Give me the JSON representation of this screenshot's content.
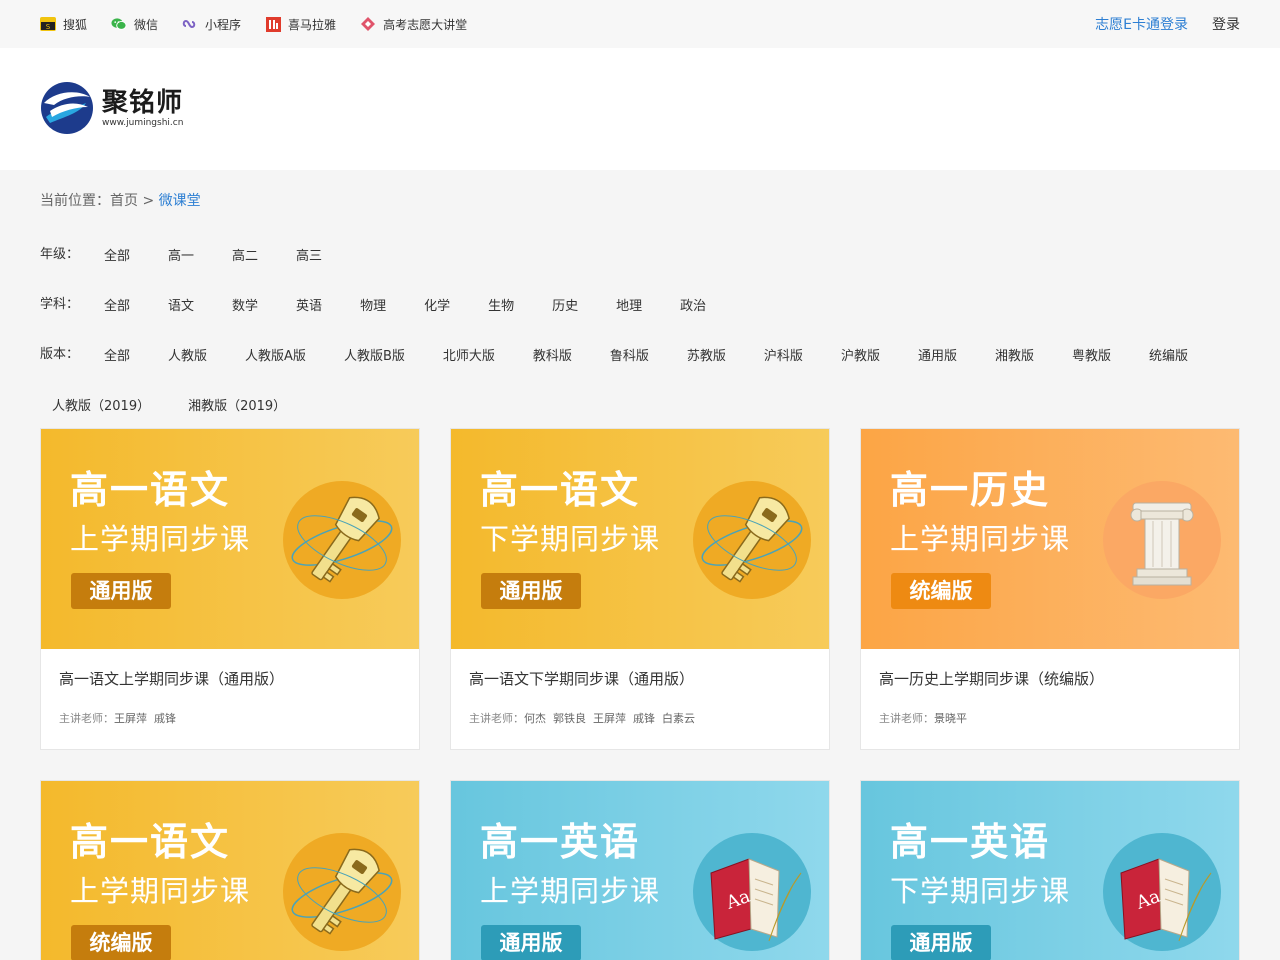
{
  "topbar": {
    "links": [
      {
        "label": "搜狐",
        "icon": "sohu-icon"
      },
      {
        "label": "微信",
        "icon": "wechat-icon"
      },
      {
        "label": "小程序",
        "icon": "miniprogram-icon"
      },
      {
        "label": "喜马拉雅",
        "icon": "ximalaya-icon"
      },
      {
        "label": "高考志愿大讲堂",
        "icon": "lecture-hall-icon"
      }
    ],
    "register_label": "志愿E卡通登录",
    "login_label": "登录"
  },
  "logo": {
    "title": "聚铭师",
    "url": "www.jumingshi.cn"
  },
  "breadcrumb": {
    "prefix": "当前位置：",
    "home": "首页",
    "separator": " > ",
    "current": "微课堂"
  },
  "filters": {
    "grade": {
      "label": "年级：",
      "options": [
        "全部",
        "高一",
        "高二",
        "高三"
      ]
    },
    "subject": {
      "label": "学科：",
      "options": [
        "全部",
        "语文",
        "数学",
        "英语",
        "物理",
        "化学",
        "生物",
        "历史",
        "地理",
        "政治"
      ]
    },
    "edition": {
      "label": "版本：",
      "options": [
        "全部",
        "人教版",
        "人教版A版",
        "人教版B版",
        "北师大版",
        "教科版",
        "鲁科版",
        "苏教版",
        "沪科版",
        "沪教版",
        "通用版",
        "湘教版",
        "粤教版",
        "统编版"
      ]
    },
    "edition_more": {
      "options": [
        "人教版（2019）",
        "湘教版（2019）"
      ]
    }
  },
  "teacher_prefix": "主讲老师：",
  "courses": [
    {
      "banner_title": "高一语文",
      "banner_sub": "上学期同步课",
      "banner_tag": "通用版",
      "title": "高一语文上学期同步课（通用版）",
      "teachers": "王屏萍  戚锋",
      "theme": "yellow",
      "art": "key-icon"
    },
    {
      "banner_title": "高一语文",
      "banner_sub": "下学期同步课",
      "banner_tag": "通用版",
      "title": "高一语文下学期同步课（通用版）",
      "teachers": "何杰  郭铁良  王屏萍  戚锋  白素云",
      "theme": "yellow",
      "art": "key-icon"
    },
    {
      "banner_title": "高一历史",
      "banner_sub": "上学期同步课",
      "banner_tag": "统编版",
      "title": "高一历史上学期同步课（统编版）",
      "teachers": "景晓平",
      "theme": "orange",
      "art": "column-icon"
    },
    {
      "banner_title": "高一语文",
      "banner_sub": "上学期同步课",
      "banner_tag": "统编版",
      "theme": "yellow",
      "art": "key-icon"
    },
    {
      "banner_title": "高一英语",
      "banner_sub": "上学期同步课",
      "banner_tag": "通用版",
      "theme": "blue",
      "art": "book-quill-icon"
    },
    {
      "banner_title": "高一英语",
      "banner_sub": "下学期同步课",
      "banner_tag": "通用版",
      "theme": "blue",
      "art": "book-quill-icon"
    }
  ],
  "colors": {
    "accent_blue": "#2d7fd3",
    "banner_yellow": "#f4b92c",
    "banner_orange": "#fca545",
    "banner_blue": "#67c6de"
  }
}
